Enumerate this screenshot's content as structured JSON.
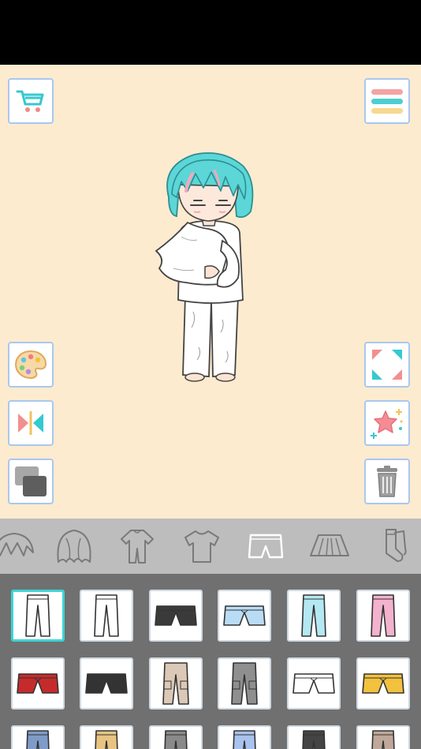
{
  "app": {
    "screen": "dress-up-editor"
  },
  "colors": {
    "stage_bg": "#fdebcf",
    "button_border": "#a9c8ef",
    "category_bar": "#bdbdbd",
    "grid_bg": "#707070",
    "selected_border": "#3fd3d3",
    "hair": "#5cd6d6",
    "hair_accent": "#f2a9bd"
  },
  "buttons": {
    "left": [
      "cart-icon",
      "palette-icon",
      "flip-icon",
      "layers-icon"
    ],
    "right": [
      "menu-icon",
      "fullscreen-icon",
      "star-effect-icon",
      "trash-icon"
    ]
  },
  "categories": [
    {
      "name": "hair-front",
      "active": false
    },
    {
      "name": "hair-back",
      "active": false
    },
    {
      "name": "outfit",
      "active": false
    },
    {
      "name": "top",
      "active": false
    },
    {
      "name": "bottom",
      "active": true
    },
    {
      "name": "skirt",
      "active": false
    },
    {
      "name": "socks",
      "active": false
    }
  ],
  "items": [
    {
      "kind": "pants",
      "color": "#ffffff",
      "selected": true
    },
    {
      "kind": "pants",
      "color": "#ffffff",
      "selected": false
    },
    {
      "kind": "shorts",
      "color": "#3a3a3a",
      "selected": false
    },
    {
      "kind": "shorts",
      "color": "#b9dcf5",
      "selected": false
    },
    {
      "kind": "pants",
      "color": "#b4e8f3",
      "selected": false
    },
    {
      "kind": "pants",
      "color": "#f3b2cd",
      "selected": false
    },
    {
      "kind": "shorts",
      "color": "#c62b2b",
      "selected": false
    },
    {
      "kind": "shorts",
      "color": "#333333",
      "selected": false
    },
    {
      "kind": "cargo",
      "color": "#dcc8b6",
      "selected": false
    },
    {
      "kind": "cargo",
      "color": "#8f8f8f",
      "selected": false
    },
    {
      "kind": "shorts",
      "color": "#ffffff",
      "selected": false
    },
    {
      "kind": "shorts",
      "color": "#f2c13d",
      "selected": false
    },
    {
      "kind": "pants",
      "color": "#7f9bc8",
      "selected": false
    },
    {
      "kind": "pants",
      "color": "#e7c482",
      "selected": false
    },
    {
      "kind": "pants",
      "color": "#8a8a8a",
      "selected": false
    },
    {
      "kind": "pants",
      "color": "#a9c2ee",
      "selected": false
    },
    {
      "kind": "pants",
      "color": "#444444",
      "selected": false
    },
    {
      "kind": "pants",
      "color": "#bfa89a",
      "selected": false
    }
  ]
}
